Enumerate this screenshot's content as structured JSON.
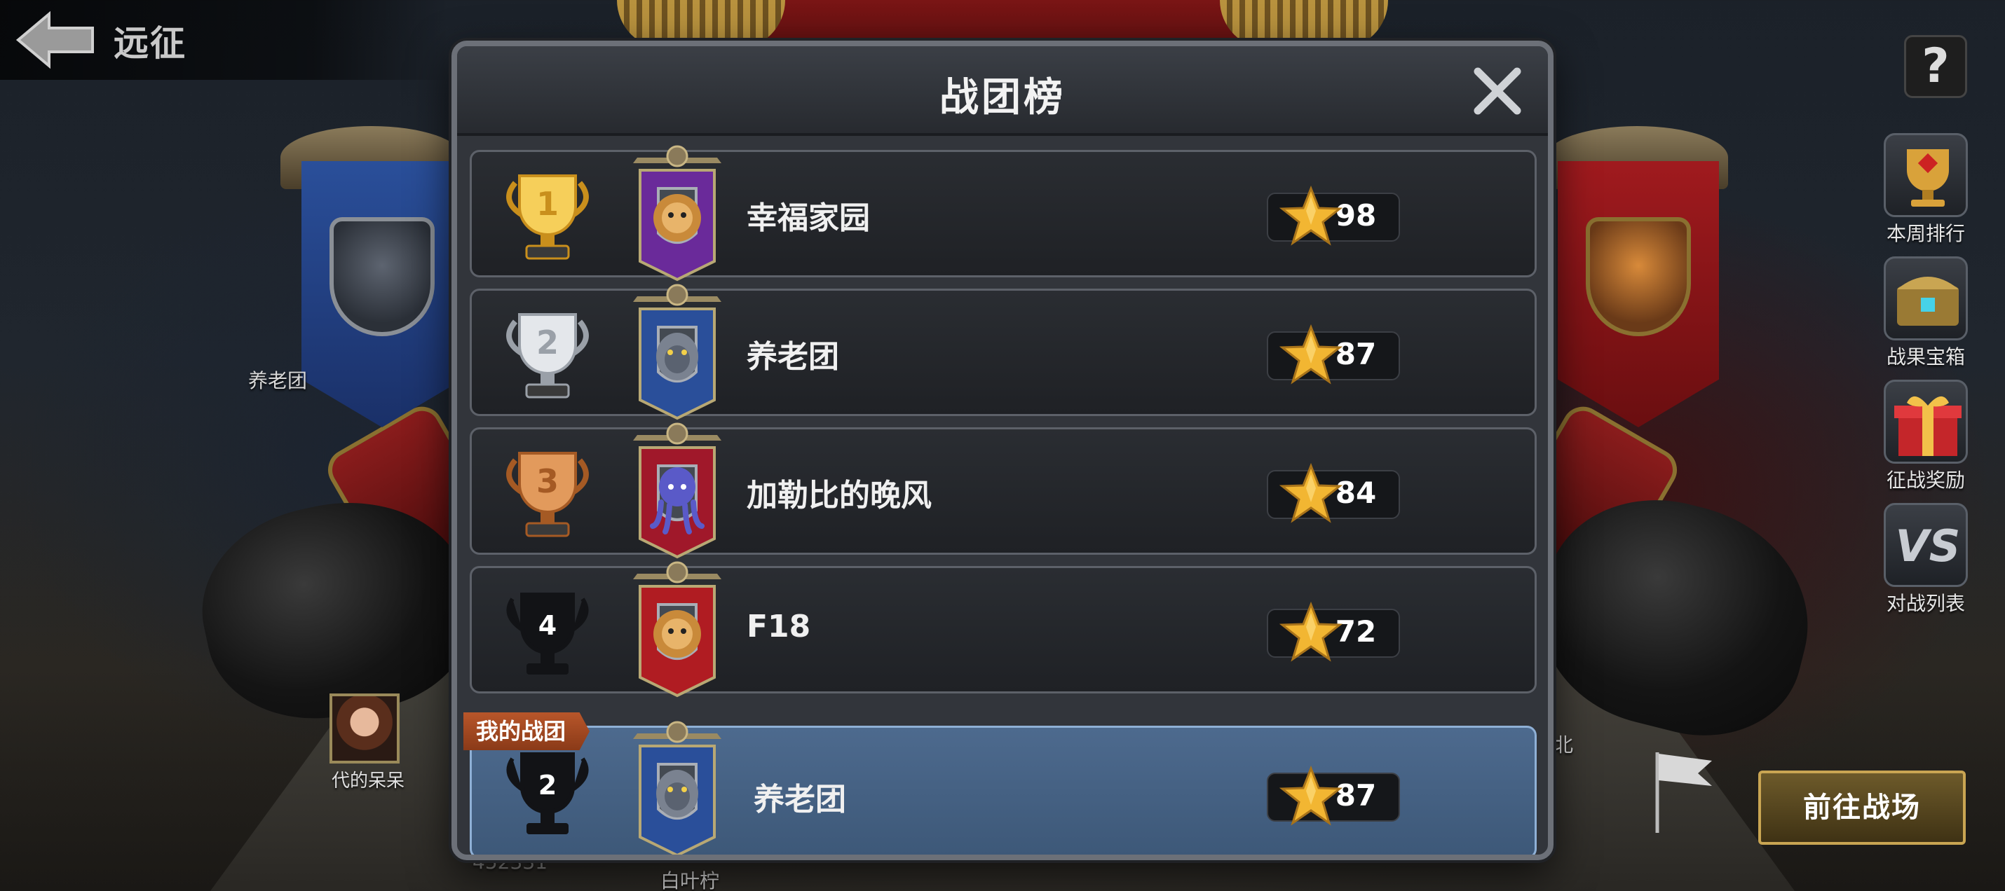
{
  "header": {
    "back_icon": "back-arrow-icon",
    "title": "远征"
  },
  "help": {
    "label": "?"
  },
  "side_buttons": [
    {
      "label": "本周排行",
      "icon": "trophy-cup-icon"
    },
    {
      "label": "战果宝箱",
      "icon": "treasure-chest-icon"
    },
    {
      "label": "征战奖励",
      "icon": "gift-box-icon"
    },
    {
      "label": "对战列表",
      "icon": "vs-icon"
    }
  ],
  "goto_button": {
    "label": "前往战场"
  },
  "background": {
    "left_banner_label": "养老团",
    "player_markers": [
      "代的呆呆",
      "白叶柠"
    ],
    "partial_labels": [
      "北",
      "452331"
    ]
  },
  "modal": {
    "title": "战团榜",
    "close_icon": "close-icon",
    "rows": [
      {
        "rank": "1",
        "name": "幸福家园",
        "score": "98",
        "trophy": "gold",
        "emblem": "lion",
        "banner_color": "#6a2a9a"
      },
      {
        "rank": "2",
        "name": "养老团",
        "score": "87",
        "trophy": "silver",
        "emblem": "panther",
        "banner_color": "#2a4f9a"
      },
      {
        "rank": "3",
        "name": "加勒比的晚风",
        "score": "84",
        "trophy": "bronze",
        "emblem": "octopus",
        "banner_color": "#a0182a"
      },
      {
        "rank": "4",
        "name": "F18",
        "score": "72",
        "trophy": "none",
        "emblem": "lion",
        "banner_color": "#b01c22"
      }
    ],
    "my_team": {
      "tag": "我的战团",
      "rank": "2",
      "name": "养老团",
      "score": "87",
      "emblem": "panther",
      "banner_color": "#2a4f9a"
    }
  },
  "colors": {
    "gold": "#f2b632",
    "silver": "#c8ccd2",
    "bronze": "#c9773a",
    "highlight_row": "#4d6a8e",
    "tag": "#b8562a"
  }
}
